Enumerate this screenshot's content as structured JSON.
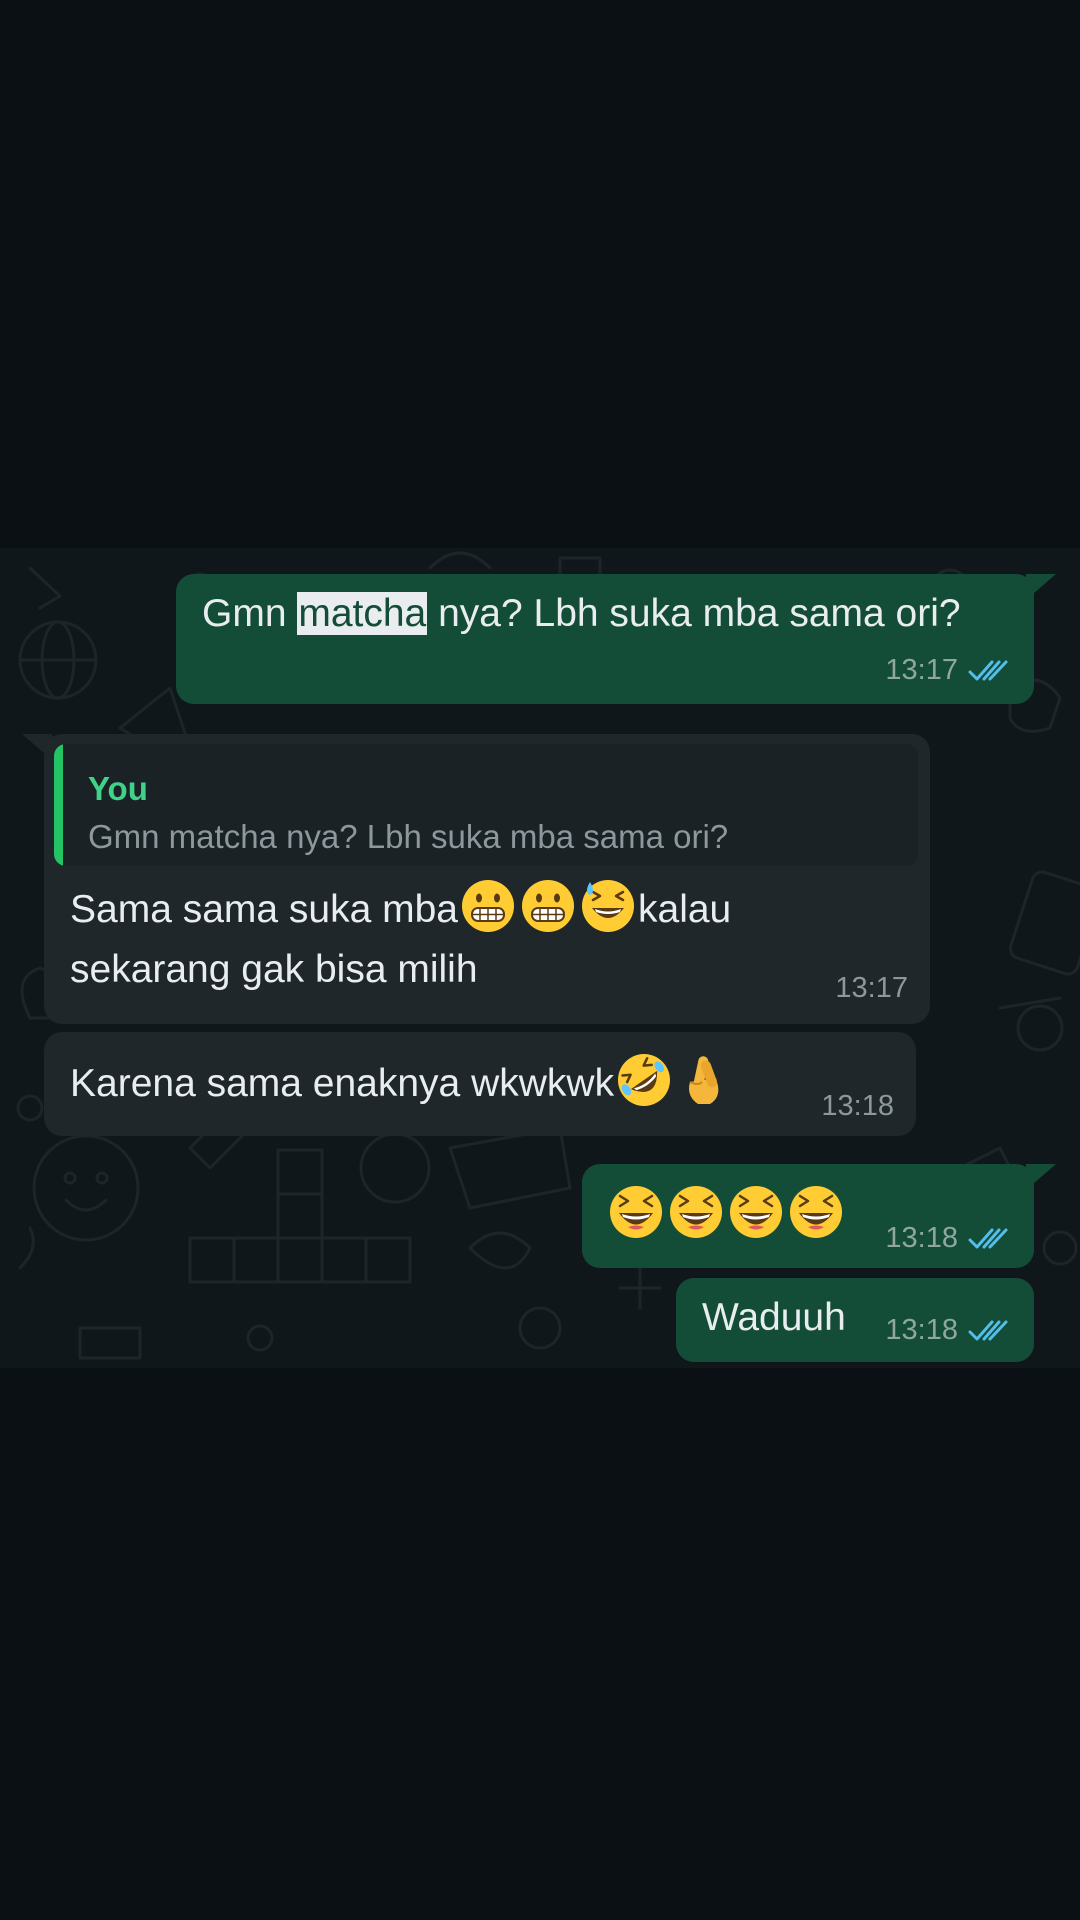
{
  "messages": [
    {
      "pre": "Gmn ",
      "highlight": "matcha",
      "post": " nya? Lbh suka mba sama ori?",
      "time": "13:17",
      "status": "read"
    },
    {
      "quote_author": "You",
      "quote_text": "Gmn matcha nya? Lbh suka mba sama ori?",
      "line1_pre": "Sama sama suka mba",
      "line1_post": "kalau",
      "line2": "sekarang gak bisa milih",
      "emojis": [
        "grimacing-face",
        "grimacing-face",
        "grinning-face-with-sweat"
      ],
      "time": "13:17"
    },
    {
      "text": "Karena sama enaknya wkwkwk",
      "emojis": [
        "rolling-on-the-floor-laughing",
        "crossed-fingers"
      ],
      "time": "13:18"
    },
    {
      "emojis": [
        "grinning-squinting-face",
        "grinning-squinting-face",
        "grinning-squinting-face",
        "grinning-squinting-face"
      ],
      "time": "13:18",
      "status": "read"
    },
    {
      "text": "Waduuh",
      "time": "13:18",
      "status": "read"
    }
  ],
  "colors": {
    "outgoing_bubble": "#144d37",
    "incoming_bubble": "#1f272b",
    "read_ticks": "#53bdeb",
    "quote_accent": "#24c466",
    "page_background": "#0b1014"
  }
}
